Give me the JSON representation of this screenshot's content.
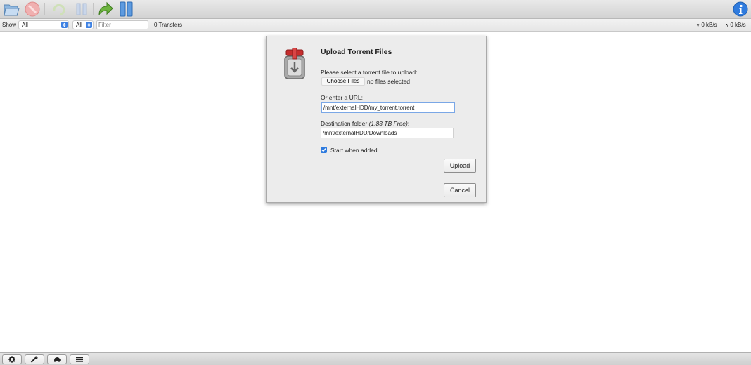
{
  "toolbar": {
    "buttons": [
      "open-icon",
      "remove-icon",
      "pause-icon",
      "resume-icon",
      "resume-all-icon",
      "pause-all-icon"
    ],
    "info_icon": "info-icon"
  },
  "filterbar": {
    "show_label": "Show",
    "state_filter": "All",
    "tracker_filter": "All",
    "filter_placeholder": "Filter",
    "transfers": "0 Transfers",
    "download_speed": "0 kB/s",
    "upload_speed": "0 kB/s"
  },
  "dialog": {
    "title": "Upload Torrent Files",
    "file_label": "Please select a torrent file to upload:",
    "choose_files": "Choose Files",
    "no_files": "no files selected",
    "url_label": "Or enter a URL:",
    "url_value": "/mnt/externalHDD/my_torrent.torrent",
    "dest_label": "Destination folder",
    "dest_free": "(1.83 TB Free)",
    "dest_colon": ":",
    "dest_value": "/mnt/externalHDD/Downloads",
    "start_label": "Start when added",
    "start_checked": true,
    "upload": "Upload",
    "cancel": "Cancel"
  },
  "bottombar": {
    "buttons": [
      "gear-icon",
      "wrench-icon",
      "turtle-icon",
      "list-icon"
    ]
  },
  "colors": {
    "accent": "#3f82e3",
    "focus": "#7aa7e6",
    "logo_red": "#c62d2d"
  }
}
